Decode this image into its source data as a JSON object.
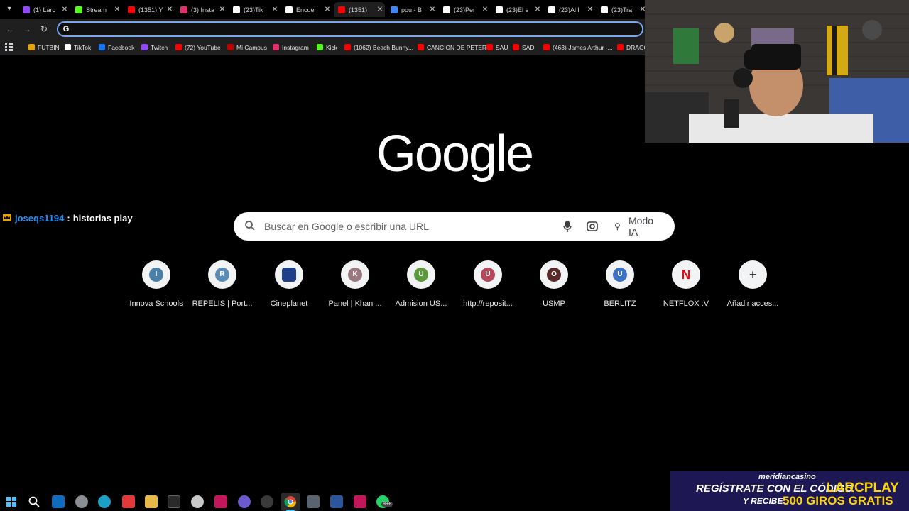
{
  "browser": {
    "tabs": [
      {
        "title": "(1) Larc",
        "color": "#9146ff"
      },
      {
        "title": "Stream",
        "color": "#53fc18"
      },
      {
        "title": "(1351) Y",
        "color": "#ff0000"
      },
      {
        "title": "(3) Insta",
        "color": "#e1306c"
      },
      {
        "title": "(23)Tik",
        "color": "#ffffff"
      },
      {
        "title": "Encuen",
        "color": "#ffffff"
      },
      {
        "title": "(1351)",
        "color": "#ff0000",
        "active": true
      },
      {
        "title": "pou - B",
        "color": "#4285f4"
      },
      {
        "title": "(23)Per",
        "color": "#ffffff"
      },
      {
        "title": "(23)El s",
        "color": "#ffffff"
      },
      {
        "title": "(23)Al l",
        "color": "#ffffff"
      },
      {
        "title": "(23)Tra",
        "color": "#ffffff"
      }
    ],
    "omnibox_value": "",
    "bookmarks": [
      {
        "label": "FUTBIN",
        "color": "#e8a400"
      },
      {
        "label": "TikTok",
        "color": "#ffffff"
      },
      {
        "label": "Facebook",
        "color": "#1877f2"
      },
      {
        "label": "Twitch",
        "color": "#9146ff"
      },
      {
        "label": "(72) YouTube",
        "color": "#ff0000"
      },
      {
        "label": "Mi Campus",
        "color": "#c00000"
      },
      {
        "label": "Instagram",
        "color": "#e1306c"
      },
      {
        "label": "Kick",
        "color": "#53fc18"
      },
      {
        "label": "(1062) Beach Bunny...",
        "color": "#ff0000"
      },
      {
        "label": "CANCION DE PETER",
        "color": "#ff0000"
      },
      {
        "label": "SAU",
        "color": "#ff0000"
      },
      {
        "label": "SAD",
        "color": "#ff0000"
      },
      {
        "label": "(463) James Arthur -...",
        "color": "#ff0000"
      },
      {
        "label": "DRAGO",
        "color": "#ff0000"
      }
    ]
  },
  "google": {
    "logo": "Google",
    "search_placeholder": "Buscar en Google o escribir una URL",
    "ai_mode_label": "Modo IA",
    "shortcuts": [
      {
        "letter": "I",
        "label": "Innova Schools",
        "color": "#4a7fa8"
      },
      {
        "letter": "R",
        "label": "REPELIS | Port...",
        "color": "#5b8cb8"
      },
      {
        "letter": "",
        "label": "Cineplanet",
        "color": "#1e3f8a"
      },
      {
        "letter": "K",
        "label": "Panel | Khan ...",
        "color": "#9a7a80"
      },
      {
        "letter": "U",
        "label": "Admision US...",
        "color": "#5a9a3a"
      },
      {
        "letter": "U",
        "label": "http://reposit...",
        "color": "#b5485a"
      },
      {
        "letter": "O",
        "label": "USMP",
        "color": "#5a2a2a"
      },
      {
        "letter": "U",
        "label": "BERLITZ",
        "color": "#3a72c8"
      },
      {
        "letter": "N",
        "label": "NETFLOX :V",
        "color": "#e50914"
      },
      {
        "letter": "+",
        "label": "Añadir acces...",
        "color": "#202124"
      }
    ]
  },
  "stream": {
    "chat_user": "joseqs1194",
    "chat_separator": ":",
    "chat_message": "historias play",
    "casino_brand": "meridiancasino",
    "casino_line1": "REGÍSTRATE CON EL CÓDIGO",
    "casino_code": "LARCPLAY",
    "casino_line2a": "Y RECIBE",
    "casino_line2b": "500 GIROS GRATIS"
  },
  "taskbar": {
    "whatsapp_badge": "99+"
  }
}
